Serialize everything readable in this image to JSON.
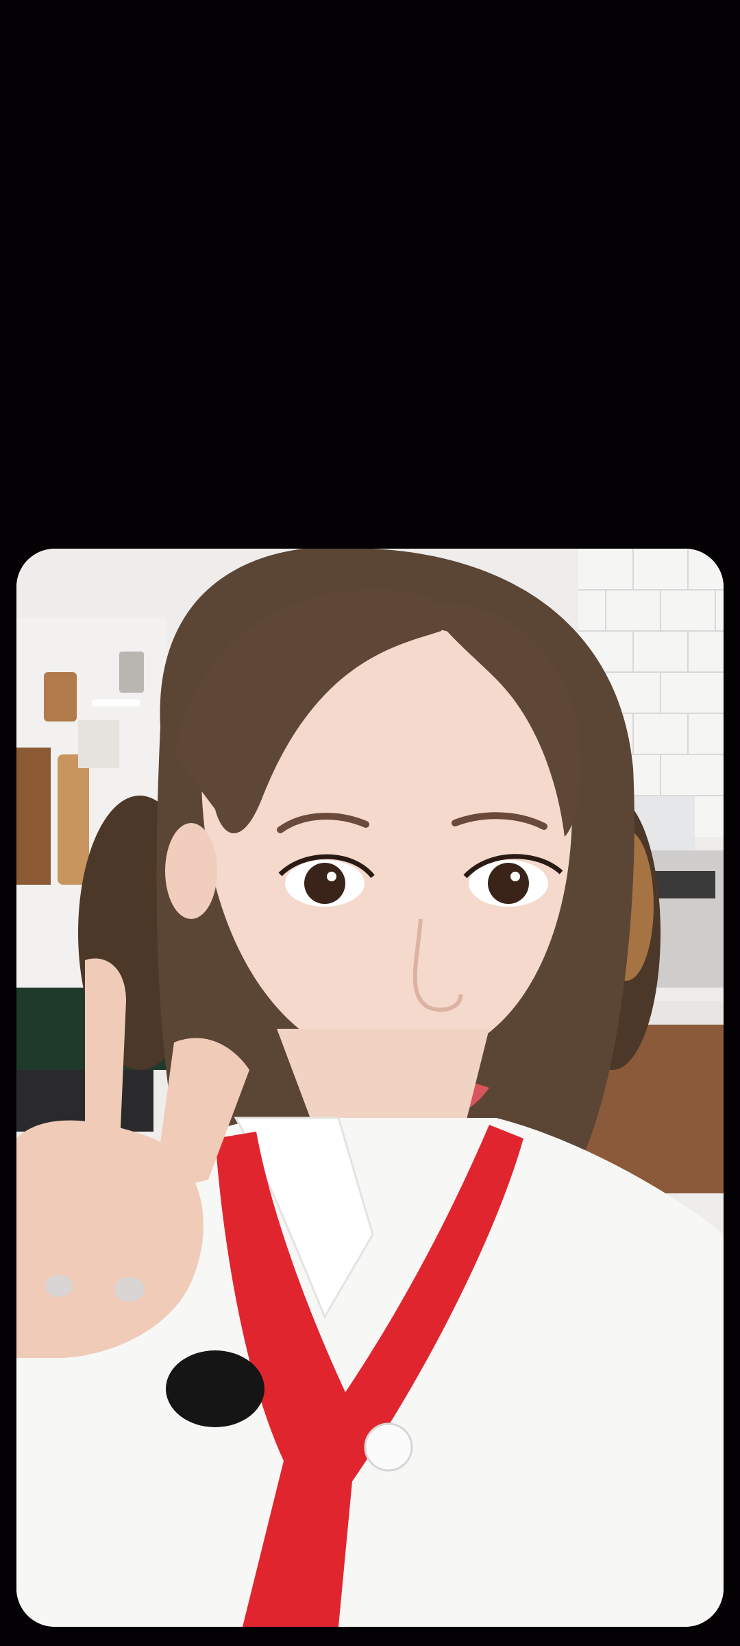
{
  "viewer": {
    "background_color": "#030103",
    "image": {
      "description_icon": "photo-icon",
      "subject": "selfie-portrait"
    }
  },
  "palette": {
    "wall": "#f3f2f0",
    "tile_grout": "#d9d9d9",
    "hair": "#5b4535",
    "skin": "#f4d9cc",
    "uniform": "#f7f7f5",
    "scarf": "#e0252f",
    "cabinet": "#8a5a3a"
  }
}
